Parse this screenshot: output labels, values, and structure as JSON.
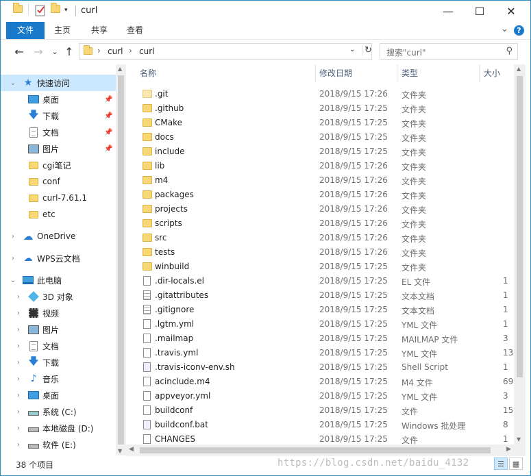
{
  "window": {
    "title": "curl",
    "minimize_glyph": "—",
    "maximize_glyph": "☐",
    "close_glyph": "✕"
  },
  "ribbon": {
    "tabs": [
      "文件",
      "主页",
      "共享",
      "查看"
    ],
    "expand_glyph": "⌄",
    "help_glyph": "?"
  },
  "nav": {
    "back_glyph": "←",
    "forward_glyph": "→",
    "recent_glyph": "⌄",
    "up_glyph": "↑"
  },
  "address": {
    "crumbs": [
      "curl",
      "curl"
    ],
    "separator": "›"
  },
  "search": {
    "placeholder": "搜索\"curl\""
  },
  "sidebar": {
    "items": [
      {
        "label": "快速访问",
        "icon": "star-icon",
        "level": 0,
        "expander": "⌄",
        "selected": true
      },
      {
        "label": "桌面",
        "icon": "desktop-icon",
        "level": 1,
        "pinned": true
      },
      {
        "label": "下载",
        "icon": "download-icon",
        "level": 1,
        "pinned": true
      },
      {
        "label": "文档",
        "icon": "document-icon",
        "level": 1,
        "pinned": true
      },
      {
        "label": "图片",
        "icon": "pictures-icon",
        "level": 1,
        "pinned": true
      },
      {
        "label": "cgi笔记",
        "icon": "folder-icon",
        "level": 1
      },
      {
        "label": "conf",
        "icon": "folder-icon",
        "level": 1
      },
      {
        "label": "curl-7.61.1",
        "icon": "folder-icon",
        "level": 1
      },
      {
        "label": "etc",
        "icon": "folder-icon",
        "level": 1
      },
      {
        "label": "OneDrive",
        "icon": "onedrive-icon",
        "level": 0,
        "expander": "›"
      },
      {
        "label": "WPS云文档",
        "icon": "wps-cloud-icon",
        "level": 0,
        "expander": "›"
      },
      {
        "label": "此电脑",
        "icon": "this-pc-icon",
        "level": 0,
        "expander": "⌄"
      },
      {
        "label": "3D 对象",
        "icon": "3d-objects-icon",
        "level": 1,
        "expander": "›"
      },
      {
        "label": "视频",
        "icon": "video-icon",
        "level": 1,
        "expander": "›"
      },
      {
        "label": "图片",
        "icon": "pictures-icon",
        "level": 1,
        "expander": "›"
      },
      {
        "label": "文档",
        "icon": "document-icon",
        "level": 1,
        "expander": "›"
      },
      {
        "label": "下载",
        "icon": "download-icon",
        "level": 1,
        "expander": "›"
      },
      {
        "label": "音乐",
        "icon": "music-icon",
        "level": 1,
        "expander": "›"
      },
      {
        "label": "桌面",
        "icon": "desktop-icon",
        "level": 1,
        "expander": "›"
      },
      {
        "label": "系统 (C:)",
        "icon": "system-drive-icon",
        "level": 1,
        "expander": "›"
      },
      {
        "label": "本地磁盘 (D:)",
        "icon": "drive-icon",
        "level": 1,
        "expander": "›"
      },
      {
        "label": "软件 (E:)",
        "icon": "drive-icon",
        "level": 1,
        "expander": "›"
      }
    ]
  },
  "columns": [
    "名称",
    "修改日期",
    "类型",
    "大小"
  ],
  "sort_glyph": "^",
  "files": [
    {
      "name": ".git",
      "date": "2018/9/15 17:26",
      "type": "文件夹",
      "size": "",
      "kind": "folder-light"
    },
    {
      "name": ".github",
      "date": "2018/9/15 17:25",
      "type": "文件夹",
      "size": "",
      "kind": "folder"
    },
    {
      "name": "CMake",
      "date": "2018/9/15 17:25",
      "type": "文件夹",
      "size": "",
      "kind": "folder"
    },
    {
      "name": "docs",
      "date": "2018/9/15 17:25",
      "type": "文件夹",
      "size": "",
      "kind": "folder"
    },
    {
      "name": "include",
      "date": "2018/9/15 17:25",
      "type": "文件夹",
      "size": "",
      "kind": "folder"
    },
    {
      "name": "lib",
      "date": "2018/9/15 17:26",
      "type": "文件夹",
      "size": "",
      "kind": "folder"
    },
    {
      "name": "m4",
      "date": "2018/9/15 17:26",
      "type": "文件夹",
      "size": "",
      "kind": "folder"
    },
    {
      "name": "packages",
      "date": "2018/9/15 17:26",
      "type": "文件夹",
      "size": "",
      "kind": "folder"
    },
    {
      "name": "projects",
      "date": "2018/9/15 17:26",
      "type": "文件夹",
      "size": "",
      "kind": "folder"
    },
    {
      "name": "scripts",
      "date": "2018/9/15 17:26",
      "type": "文件夹",
      "size": "",
      "kind": "folder"
    },
    {
      "name": "src",
      "date": "2018/9/15 17:26",
      "type": "文件夹",
      "size": "",
      "kind": "folder"
    },
    {
      "name": "tests",
      "date": "2018/9/15 17:26",
      "type": "文件夹",
      "size": "",
      "kind": "folder"
    },
    {
      "name": "winbuild",
      "date": "2018/9/15 17:25",
      "type": "文件夹",
      "size": "",
      "kind": "folder"
    },
    {
      "name": ".dir-locals.el",
      "date": "2018/9/15 17:25",
      "type": "EL 文件",
      "size": "1",
      "kind": "file"
    },
    {
      "name": ".gitattributes",
      "date": "2018/9/15 17:25",
      "type": "文本文档",
      "size": "1",
      "kind": "file-lines"
    },
    {
      "name": ".gitignore",
      "date": "2018/9/15 17:25",
      "type": "文本文档",
      "size": "1",
      "kind": "file-lines"
    },
    {
      "name": ".lgtm.yml",
      "date": "2018/9/15 17:25",
      "type": "YML 文件",
      "size": "1",
      "kind": "file"
    },
    {
      "name": ".mailmap",
      "date": "2018/9/15 17:25",
      "type": "MAILMAP 文件",
      "size": "3",
      "kind": "file"
    },
    {
      "name": ".travis.yml",
      "date": "2018/9/15 17:25",
      "type": "YML 文件",
      "size": "13",
      "kind": "file"
    },
    {
      "name": ".travis-iconv-env.sh",
      "date": "2018/9/15 17:25",
      "type": "Shell Script",
      "size": "1",
      "kind": "file-script"
    },
    {
      "name": "acinclude.m4",
      "date": "2018/9/15 17:25",
      "type": "M4 文件",
      "size": "69",
      "kind": "file"
    },
    {
      "name": "appveyor.yml",
      "date": "2018/9/15 17:25",
      "type": "YML 文件",
      "size": "3",
      "kind": "file"
    },
    {
      "name": "buildconf",
      "date": "2018/9/15 17:25",
      "type": "文件",
      "size": "15",
      "kind": "file"
    },
    {
      "name": "buildconf.bat",
      "date": "2018/9/15 17:25",
      "type": "Windows 批处理",
      "size": "8",
      "kind": "file-script"
    },
    {
      "name": "CHANGES",
      "date": "2018/9/15 17:25",
      "type": "文件",
      "size": "1",
      "kind": "file"
    }
  ],
  "status": {
    "item_count": "38 个项目",
    "watermark": "https://blog.csdn.net/baidu_4132"
  }
}
